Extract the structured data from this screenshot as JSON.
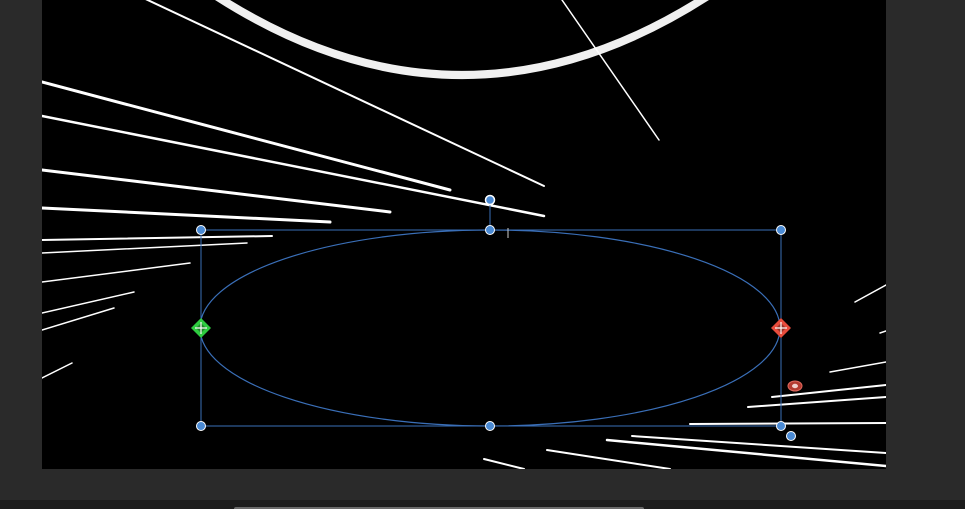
{
  "app": {
    "name": "vector-editor-canvas"
  },
  "colors": {
    "canvas_background": "#000000",
    "workspace_background": "#2a2a2a",
    "selection_accent": "#3a6fb8",
    "handle_fill": "#4a8ad4",
    "start_point": "#2ecc40",
    "end_point": "#e74c3c",
    "shape_stroke": "#ffffff"
  },
  "icons": {
    "start_marker": "green-start-point-icon",
    "end_marker": "red-end-point-icon",
    "extra_marker": "red-eye-point-icon"
  }
}
